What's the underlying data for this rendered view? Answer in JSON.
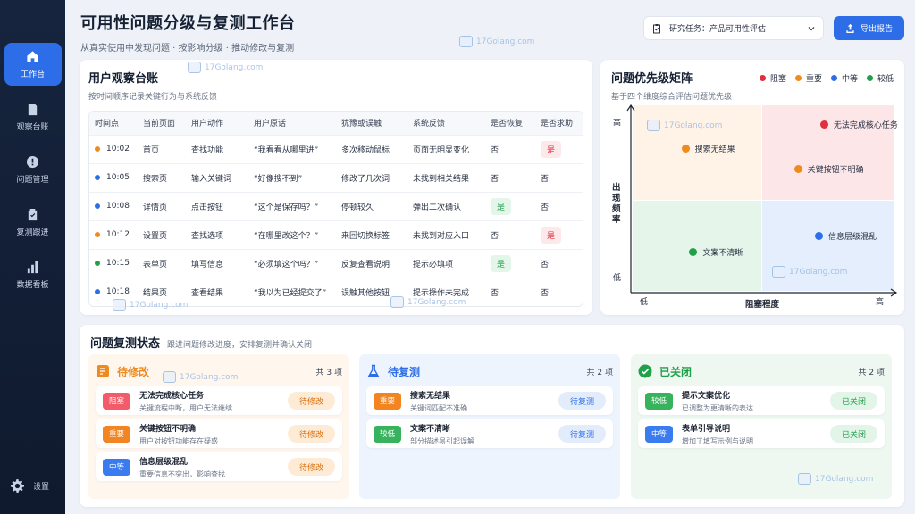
{
  "sidebar": {
    "items": [
      {
        "label": "工作台",
        "icon": "home-icon"
      },
      {
        "label": "观察台账",
        "icon": "document-icon"
      },
      {
        "label": "问题管理",
        "icon": "alert-icon"
      },
      {
        "label": "复测跟进",
        "icon": "clipboard-check-icon"
      },
      {
        "label": "数据看板",
        "icon": "bar-chart-icon"
      }
    ],
    "settings_label": "设置"
  },
  "header": {
    "title": "可用性问题分级与复测工作台",
    "subtitle": "从真实使用中发现问题 · 按影响分级 · 推动修改与复测",
    "task_select": "研究任务：产品可用性评估",
    "export_label": "导出报告"
  },
  "observation": {
    "title": "用户观察台账",
    "subtitle": "按时间顺序记录关键行为与系统反馈",
    "columns": [
      "时间点",
      "当前页面",
      "用户动作",
      "用户原话",
      "犹豫或误触",
      "系统反馈",
      "是否恢复",
      "是否求助"
    ],
    "rows": [
      {
        "dot": "#ef8a1f",
        "time": "10:02",
        "page": "首页",
        "action": "查找功能",
        "quote": "“我看看从哪里进”",
        "hesitation": "多次移动鼠标",
        "feedback": "页面无明显变化",
        "recovered": "否",
        "recovered_style": "plain",
        "help": "是",
        "help_style": "red"
      },
      {
        "dot": "#2d6ee8",
        "time": "10:05",
        "page": "搜索页",
        "action": "输入关键词",
        "quote": "“好像搜不到”",
        "hesitation": "修改了几次词",
        "feedback": "未找到相关结果",
        "recovered": "否",
        "recovered_style": "plain",
        "help": "否",
        "help_style": "plain"
      },
      {
        "dot": "#2d6ee8",
        "time": "10:08",
        "page": "详情页",
        "action": "点击按钮",
        "quote": "“这个是保存吗？”",
        "hesitation": "停顿较久",
        "feedback": "弹出二次确认",
        "recovered": "是",
        "recovered_style": "green",
        "help": "否",
        "help_style": "plain"
      },
      {
        "dot": "#ef8a1f",
        "time": "10:12",
        "page": "设置页",
        "action": "查找选项",
        "quote": "“在哪里改这个？”",
        "hesitation": "来回切换标签",
        "feedback": "未找到对应入口",
        "recovered": "否",
        "recovered_style": "plain",
        "help": "是",
        "help_style": "red"
      },
      {
        "dot": "#21a04a",
        "time": "10:15",
        "page": "表单页",
        "action": "填写信息",
        "quote": "“必须填这个吗？”",
        "hesitation": "反复查看说明",
        "feedback": "提示必填项",
        "recovered": "是",
        "recovered_style": "green",
        "help": "否",
        "help_style": "plain"
      },
      {
        "dot": "#2d6ee8",
        "time": "10:18",
        "page": "结果页",
        "action": "查看结果",
        "quote": "“我以为已经提交了”",
        "hesitation": "误触其他按钮",
        "feedback": "提示操作未完成",
        "recovered": "否",
        "recovered_style": "plain",
        "help": "否",
        "help_style": "plain"
      }
    ]
  },
  "matrix": {
    "title": "问题优先级矩阵",
    "subtitle": "基于四个维度综合评估问题优先级",
    "legend": [
      {
        "label": "阻塞",
        "color": "#e0303f"
      },
      {
        "label": "重要",
        "color": "#ef8a1f"
      },
      {
        "label": "中等",
        "color": "#2d6ee8"
      },
      {
        "label": "较低",
        "color": "#21a04a"
      }
    ],
    "y_label": "出现频率",
    "y_high": "高",
    "y_low": "低",
    "x_label": "阻塞程度",
    "x_low": "低",
    "x_high": "高",
    "points": [
      {
        "label": "搜索无结果",
        "color": "#ef8a1f",
        "x": 0.2,
        "y": 0.77
      },
      {
        "label": "无法完成核心任务",
        "color": "#e0303f",
        "x": 0.73,
        "y": 0.9
      },
      {
        "label": "关键按钮不明确",
        "color": "#ef8a1f",
        "x": 0.63,
        "y": 0.66
      },
      {
        "label": "信息层级混乱",
        "color": "#2d6ee8",
        "x": 0.71,
        "y": 0.3
      },
      {
        "label": "文案不清晰",
        "color": "#21a04a",
        "x": 0.23,
        "y": 0.21
      }
    ]
  },
  "retest": {
    "title": "问题复测状态",
    "hint": "跟进问题修改进度，安排复测并确认关闭",
    "columns": [
      {
        "title": "待修改",
        "count": "共 3 项",
        "icon": "edit-box-icon",
        "color": "#ef8a1f",
        "bg": "#fff6ee",
        "items": [
          {
            "tag": "阻塞",
            "tag_color": "#f45b6a",
            "title": "无法完成核心任务",
            "desc": "关键流程中断，用户无法继续",
            "status": "待修改"
          },
          {
            "tag": "重要",
            "tag_color": "#f28422",
            "title": "关键按钮不明确",
            "desc": "用户对按钮功能存在疑惑",
            "status": "待修改"
          },
          {
            "tag": "中等",
            "tag_color": "#3a7cf0",
            "title": "信息层级混乱",
            "desc": "重要信息不突出，影响查找",
            "status": "待修改"
          }
        ]
      },
      {
        "title": "待复测",
        "count": "共 2 项",
        "icon": "flask-icon",
        "color": "#2d6ee8",
        "bg": "#eef4fd",
        "items": [
          {
            "tag": "重要",
            "tag_color": "#f28422",
            "title": "搜索无结果",
            "desc": "关键词匹配不准确",
            "status": "待复测"
          },
          {
            "tag": "较低",
            "tag_color": "#36b35c",
            "title": "文案不清晰",
            "desc": "部分描述易引起误解",
            "status": "待复测"
          }
        ]
      },
      {
        "title": "已关闭",
        "count": "共 2 项",
        "icon": "check-circle-icon",
        "color": "#21a04a",
        "bg": "#eef8f1",
        "items": [
          {
            "tag": "较低",
            "tag_color": "#36b35c",
            "title": "提示文案优化",
            "desc": "已调整为更清晰的表达",
            "status": "已关闭"
          },
          {
            "tag": "中等",
            "tag_color": "#3a7cf0",
            "title": "表单引导说明",
            "desc": "增加了填写示例与说明",
            "status": "已关闭"
          }
        ]
      }
    ]
  },
  "watermark": "17Golang.com"
}
